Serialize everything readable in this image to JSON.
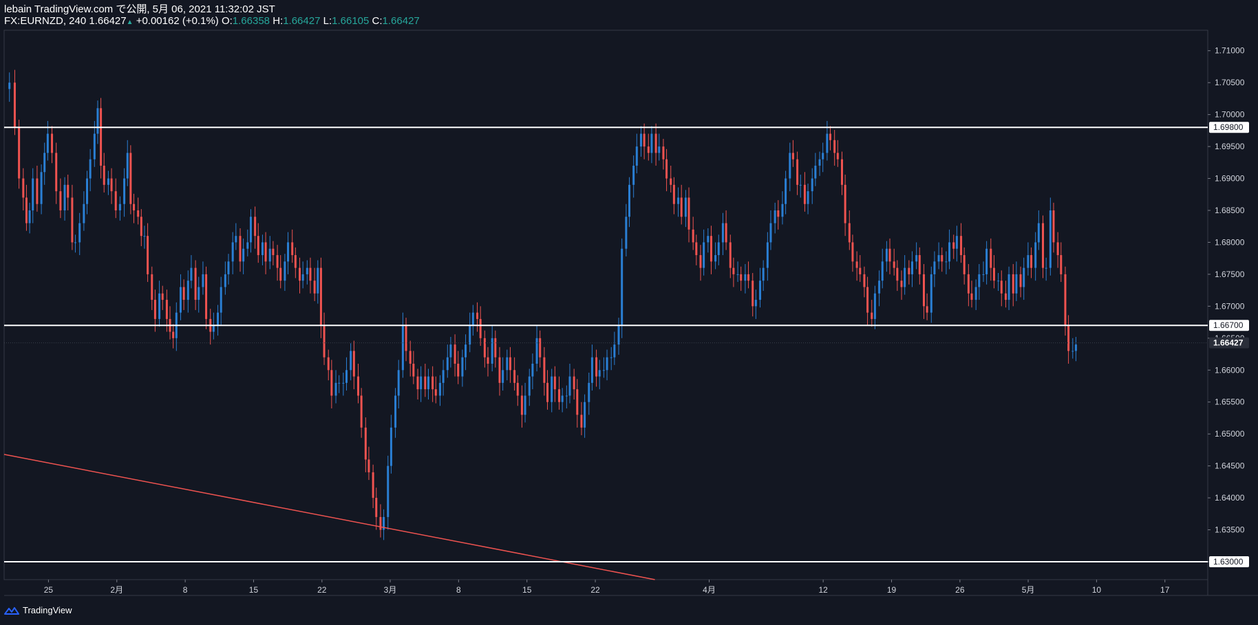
{
  "header": {
    "line1": "lebain TradingView.com で公開, 5月 06, 2021 11:32:02 JST",
    "symbol": "FX:EURNZD, 240",
    "last": "1.66427",
    "change": "+0.00162 (+0.1%)",
    "o_label": "O:",
    "o_value": "1.66358",
    "h_label": "H:",
    "h_value": "1.66427",
    "l_label": "L:",
    "l_value": "1.66105",
    "c_label": "C:",
    "c_value": "1.66427"
  },
  "footer": {
    "brand": "TradingView",
    "logo_icon": "tradingview-logo-icon"
  },
  "colors": {
    "background": "#131722",
    "up": "#2a7fd4",
    "down": "#ef5350",
    "line": "#ffffff",
    "text": "#d1d4dc"
  },
  "chart_data": {
    "type": "candlestick",
    "symbol": "FX:EURNZD",
    "interval": "240",
    "y_range": [
      1.6272,
      1.7132
    ],
    "y_ticks": [
      "1.71000",
      "1.70500",
      "1.70000",
      "1.69500",
      "1.69000",
      "1.68500",
      "1.68000",
      "1.67500",
      "1.67000",
      "1.66500",
      "1.66000",
      "1.65500",
      "1.65000",
      "1.64500",
      "1.64000",
      "1.63500",
      "1.63000"
    ],
    "x_ticks": [
      {
        "label": "25",
        "x": -6.43
      },
      {
        "label": "2月",
        "x": 0
      },
      {
        "label": "8",
        "x": 6.43
      },
      {
        "label": "15",
        "x": 12.86
      },
      {
        "label": "22",
        "x": 19.29
      },
      {
        "label": "3月",
        "x": 25.71
      },
      {
        "label": "8",
        "x": 32.14
      },
      {
        "label": "15",
        "x": 38.57
      },
      {
        "label": "22",
        "x": 45
      },
      {
        "label": "4月",
        "x": 55.71
      },
      {
        "label": "12",
        "x": 66.43
      },
      {
        "label": "19",
        "x": 72.86
      },
      {
        "label": "26",
        "x": 79.29
      },
      {
        "label": "5月",
        "x": 85.71
      },
      {
        "label": "10",
        "x": 92.14
      },
      {
        "label": "17",
        "x": 98.57
      }
    ],
    "x_range": [
      -10.6,
      102.6
    ],
    "horizontal_levels": [
      {
        "value": 1.698,
        "label": "1.69800"
      },
      {
        "value": 1.667,
        "label": "1.66700"
      },
      {
        "value": 1.63,
        "label": "1.63000"
      }
    ],
    "current_price": {
      "value": 1.66427,
      "label": "1.66427"
    },
    "trendline": {
      "points": [
        {
          "x": -10.6,
          "y": 1.6468
        },
        {
          "x": 50.6,
          "y": 1.6272
        }
      ],
      "color": "#ef5350"
    },
    "price_path": [
      [
        -10.6,
        1.704
      ],
      [
        -10.1,
        1.705
      ],
      [
        -9.6,
        1.698
      ],
      [
        -9.2,
        1.69
      ],
      [
        -8.8,
        1.687
      ],
      [
        -8.5,
        1.683
      ],
      [
        -8.2,
        1.685
      ],
      [
        -7.9,
        1.69
      ],
      [
        -7.5,
        1.686
      ],
      [
        -7.1,
        1.691
      ],
      [
        -6.8,
        1.694
      ],
      [
        -6.5,
        1.697
      ],
      [
        -6.1,
        1.694
      ],
      [
        -5.7,
        1.688
      ],
      [
        -5.3,
        1.685
      ],
      [
        -4.9,
        1.689
      ],
      [
        -4.6,
        1.687
      ],
      [
        -4.2,
        1.68
      ],
      [
        -3.9,
        1.68
      ],
      [
        -3.5,
        1.683
      ],
      [
        -3.1,
        1.686
      ],
      [
        -2.8,
        1.69
      ],
      [
        -2.5,
        1.693
      ],
      [
        -2.1,
        1.697
      ],
      [
        -1.8,
        1.701
      ],
      [
        -1.5,
        1.692
      ],
      [
        -1.2,
        1.689
      ],
      [
        -0.8,
        1.69
      ],
      [
        -0.5,
        1.688
      ],
      [
        -0.1,
        1.685
      ],
      [
        0.3,
        1.686
      ],
      [
        0.7,
        1.69
      ],
      [
        1.0,
        1.694
      ],
      [
        1.3,
        1.686
      ],
      [
        1.6,
        1.685
      ],
      [
        2.0,
        1.684
      ],
      [
        2.3,
        1.681
      ],
      [
        2.6,
        1.681
      ],
      [
        2.9,
        1.675
      ],
      [
        3.3,
        1.671
      ],
      [
        3.6,
        1.668
      ],
      [
        4.0,
        1.672
      ],
      [
        4.3,
        1.671
      ],
      [
        4.7,
        1.668
      ],
      [
        5.0,
        1.666
      ],
      [
        5.3,
        1.665
      ],
      [
        5.6,
        1.669
      ],
      [
        6.0,
        1.673
      ],
      [
        6.3,
        1.671
      ],
      [
        6.7,
        1.674
      ],
      [
        7.0,
        1.676
      ],
      [
        7.4,
        1.671
      ],
      [
        7.7,
        1.673
      ],
      [
        8.1,
        1.675
      ],
      [
        8.4,
        1.668
      ],
      [
        8.8,
        1.666
      ],
      [
        9.1,
        1.667
      ],
      [
        9.5,
        1.669
      ],
      [
        9.8,
        1.673
      ],
      [
        10.2,
        1.675
      ],
      [
        10.5,
        1.677
      ],
      [
        10.9,
        1.68
      ],
      [
        11.2,
        1.681
      ],
      [
        11.6,
        1.677
      ],
      [
        11.9,
        1.679
      ],
      [
        12.3,
        1.68
      ],
      [
        12.6,
        1.684
      ],
      [
        13.0,
        1.681
      ],
      [
        13.3,
        1.678
      ],
      [
        13.7,
        1.68
      ],
      [
        14.0,
        1.677
      ],
      [
        14.4,
        1.679
      ],
      [
        14.7,
        1.678
      ],
      [
        15.1,
        1.676
      ],
      [
        15.4,
        1.674
      ],
      [
        15.8,
        1.677
      ],
      [
        16.1,
        1.68
      ],
      [
        16.5,
        1.678
      ],
      [
        16.8,
        1.676
      ],
      [
        17.2,
        1.674
      ],
      [
        17.5,
        1.675
      ],
      [
        17.9,
        1.676
      ],
      [
        18.2,
        1.674
      ],
      [
        18.6,
        1.672
      ],
      [
        18.9,
        1.676
      ],
      [
        19.2,
        1.667
      ],
      [
        19.5,
        1.662
      ],
      [
        19.9,
        1.66
      ],
      [
        20.2,
        1.656
      ],
      [
        20.6,
        1.658
      ],
      [
        20.9,
        1.658
      ],
      [
        21.3,
        1.658
      ],
      [
        21.6,
        1.66
      ],
      [
        22.0,
        1.663
      ],
      [
        22.3,
        1.659
      ],
      [
        22.7,
        1.656
      ],
      [
        23.0,
        1.651
      ],
      [
        23.4,
        1.646
      ],
      [
        23.7,
        1.644
      ],
      [
        24.1,
        1.64
      ],
      [
        24.4,
        1.637
      ],
      [
        24.8,
        1.635
      ],
      [
        25.1,
        1.637
      ],
      [
        25.5,
        1.645
      ],
      [
        25.8,
        1.651
      ],
      [
        26.2,
        1.656
      ],
      [
        26.5,
        1.66
      ],
      [
        26.9,
        1.667
      ],
      [
        27.2,
        1.663
      ],
      [
        27.6,
        1.661
      ],
      [
        27.9,
        1.659
      ],
      [
        28.3,
        1.657
      ],
      [
        28.6,
        1.659
      ],
      [
        29.0,
        1.657
      ],
      [
        29.3,
        1.659
      ],
      [
        29.7,
        1.657
      ],
      [
        30.0,
        1.656
      ],
      [
        30.4,
        1.658
      ],
      [
        30.7,
        1.66
      ],
      [
        31.1,
        1.662
      ],
      [
        31.4,
        1.664
      ],
      [
        31.8,
        1.661
      ],
      [
        32.1,
        1.659
      ],
      [
        32.5,
        1.662
      ],
      [
        32.8,
        1.664
      ],
      [
        33.2,
        1.667
      ],
      [
        33.5,
        1.669
      ],
      [
        33.9,
        1.668
      ],
      [
        34.2,
        1.665
      ],
      [
        34.6,
        1.662
      ],
      [
        34.9,
        1.661
      ],
      [
        35.3,
        1.665
      ],
      [
        35.6,
        1.662
      ],
      [
        36.0,
        1.658
      ],
      [
        36.3,
        1.66
      ],
      [
        36.7,
        1.662
      ],
      [
        37.0,
        1.66
      ],
      [
        37.4,
        1.658
      ],
      [
        37.7,
        1.656
      ],
      [
        38.1,
        1.653
      ],
      [
        38.4,
        1.656
      ],
      [
        38.8,
        1.659
      ],
      [
        39.1,
        1.661
      ],
      [
        39.5,
        1.665
      ],
      [
        39.8,
        1.662
      ],
      [
        40.2,
        1.658
      ],
      [
        40.5,
        1.655
      ],
      [
        40.9,
        1.659
      ],
      [
        41.2,
        1.657
      ],
      [
        41.6,
        1.655
      ],
      [
        41.9,
        1.656
      ],
      [
        42.3,
        1.656
      ],
      [
        42.6,
        1.659
      ],
      [
        43.0,
        1.657
      ],
      [
        43.3,
        1.653
      ],
      [
        43.7,
        1.651
      ],
      [
        44.0,
        1.655
      ],
      [
        44.4,
        1.658
      ],
      [
        44.7,
        1.662
      ],
      [
        45.1,
        1.659
      ],
      [
        45.4,
        1.66
      ],
      [
        45.8,
        1.66
      ],
      [
        46.1,
        1.662
      ],
      [
        46.5,
        1.662
      ],
      [
        46.8,
        1.664
      ],
      [
        47.2,
        1.667
      ],
      [
        47.5,
        1.679
      ],
      [
        47.9,
        1.684
      ],
      [
        48.2,
        1.689
      ],
      [
        48.6,
        1.692
      ],
      [
        48.9,
        1.695
      ],
      [
        49.3,
        1.697
      ],
      [
        49.6,
        1.695
      ],
      [
        50.0,
        1.694
      ],
      [
        50.3,
        1.697
      ],
      [
        50.7,
        1.694
      ],
      [
        51.0,
        1.695
      ],
      [
        51.4,
        1.693
      ],
      [
        51.7,
        1.69
      ],
      [
        52.1,
        1.689
      ],
      [
        52.4,
        1.686
      ],
      [
        52.8,
        1.687
      ],
      [
        53.1,
        1.684
      ],
      [
        53.5,
        1.687
      ],
      [
        53.8,
        1.682
      ],
      [
        54.2,
        1.68
      ],
      [
        54.5,
        1.678
      ],
      [
        54.9,
        1.676
      ],
      [
        55.2,
        1.68
      ],
      [
        55.6,
        1.681
      ],
      [
        55.9,
        1.677
      ],
      [
        56.3,
        1.678
      ],
      [
        56.6,
        1.68
      ],
      [
        57.0,
        1.683
      ],
      [
        57.3,
        1.68
      ],
      [
        57.7,
        1.676
      ],
      [
        58.0,
        1.675
      ],
      [
        58.4,
        1.675
      ],
      [
        58.7,
        1.674
      ],
      [
        59.1,
        1.675
      ],
      [
        59.4,
        1.674
      ],
      [
        59.8,
        1.67
      ],
      [
        60.1,
        1.671
      ],
      [
        60.5,
        1.674
      ],
      [
        60.8,
        1.676
      ],
      [
        61.2,
        1.68
      ],
      [
        61.5,
        1.683
      ],
      [
        61.9,
        1.685
      ],
      [
        62.2,
        1.684
      ],
      [
        62.6,
        1.686
      ],
      [
        62.9,
        1.69
      ],
      [
        63.3,
        1.694
      ],
      [
        63.6,
        1.693
      ],
      [
        64.0,
        1.689
      ],
      [
        64.3,
        1.689
      ],
      [
        64.7,
        1.686
      ],
      [
        65.0,
        1.688
      ],
      [
        65.4,
        1.69
      ],
      [
        65.7,
        1.692
      ],
      [
        66.1,
        1.693
      ],
      [
        66.4,
        1.694
      ],
      [
        66.8,
        1.697
      ],
      [
        67.1,
        1.696
      ],
      [
        67.5,
        1.694
      ],
      [
        67.8,
        1.693
      ],
      [
        68.2,
        1.689
      ],
      [
        68.5,
        1.683
      ],
      [
        68.9,
        1.68
      ],
      [
        69.2,
        1.677
      ],
      [
        69.6,
        1.676
      ],
      [
        69.9,
        1.675
      ],
      [
        70.3,
        1.673
      ],
      [
        70.6,
        1.669
      ],
      [
        71.0,
        1.668
      ],
      [
        71.3,
        1.672
      ],
      [
        71.7,
        1.674
      ],
      [
        72.0,
        1.677
      ],
      [
        72.4,
        1.679
      ],
      [
        72.7,
        1.677
      ],
      [
        73.1,
        1.676
      ],
      [
        73.4,
        1.674
      ],
      [
        73.8,
        1.673
      ],
      [
        74.1,
        1.676
      ],
      [
        74.5,
        1.675
      ],
      [
        74.8,
        1.677
      ],
      [
        75.2,
        1.678
      ],
      [
        75.5,
        1.675
      ],
      [
        75.9,
        1.67
      ],
      [
        76.2,
        1.669
      ],
      [
        76.6,
        1.675
      ],
      [
        76.9,
        1.677
      ],
      [
        77.3,
        1.678
      ],
      [
        77.6,
        1.677
      ],
      [
        78.0,
        1.677
      ],
      [
        78.3,
        1.68
      ],
      [
        78.7,
        1.679
      ],
      [
        79.0,
        1.681
      ],
      [
        79.4,
        1.678
      ],
      [
        79.7,
        1.675
      ],
      [
        80.1,
        1.672
      ],
      [
        80.4,
        1.671
      ],
      [
        80.8,
        1.673
      ],
      [
        81.1,
        1.675
      ],
      [
        81.5,
        1.675
      ],
      [
        81.8,
        1.679
      ],
      [
        82.2,
        1.676
      ],
      [
        82.5,
        1.674
      ],
      [
        82.9,
        1.674
      ],
      [
        83.2,
        1.672
      ],
      [
        83.6,
        1.671
      ],
      [
        83.9,
        1.675
      ],
      [
        84.3,
        1.672
      ],
      [
        84.6,
        1.675
      ],
      [
        85.0,
        1.673
      ],
      [
        85.3,
        1.676
      ],
      [
        85.7,
        1.678
      ],
      [
        86.0,
        1.676
      ],
      [
        86.4,
        1.68
      ],
      [
        86.7,
        1.683
      ],
      [
        87.1,
        1.676
      ],
      [
        87.4,
        1.676
      ],
      [
        87.8,
        1.685
      ],
      [
        88.1,
        1.68
      ],
      [
        88.5,
        1.678
      ],
      [
        88.8,
        1.675
      ],
      [
        89.2,
        1.667
      ],
      [
        89.5,
        1.663
      ],
      [
        89.9,
        1.663
      ],
      [
        90.2,
        1.664
      ]
    ]
  }
}
